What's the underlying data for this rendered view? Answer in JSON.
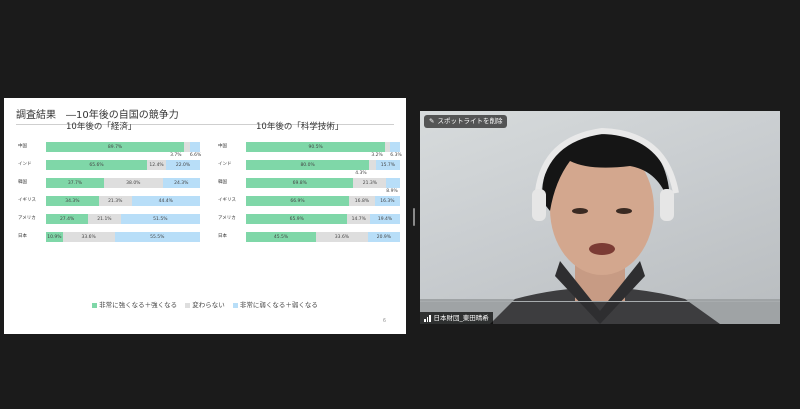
{
  "slide": {
    "title": "調査結果　―10年後の自国の競争力",
    "page_number": "6",
    "legend": [
      {
        "label": "非常に強くなる＋強くなる",
        "color": "#7fd7a8"
      },
      {
        "label": "変わらない",
        "color": "#dedede"
      },
      {
        "label": "非常に弱くなる＋弱くなる",
        "color": "#b8def8"
      }
    ]
  },
  "chart_data": [
    {
      "type": "bar",
      "title": "10年後の「経済」",
      "categories": [
        "中国",
        "インド",
        "韓国",
        "イギリス",
        "アメリカ",
        "日本"
      ],
      "series": [
        {
          "name": "非常に強くなる＋強くなる",
          "values": [
            89.7,
            65.6,
            37.7,
            34.3,
            27.4,
            10.9
          ]
        },
        {
          "name": "変わらない",
          "values": [
            3.7,
            12.4,
            38.0,
            21.3,
            21.1,
            33.6
          ]
        },
        {
          "name": "非常に弱くなる＋弱くなる",
          "values": [
            6.6,
            22.0,
            24.3,
            44.4,
            51.5,
            55.5
          ]
        }
      ],
      "labels": [
        [
          "89.7%",
          "3.7%",
          "6.6%"
        ],
        [
          "65.6%",
          "12.4%",
          "22.0%"
        ],
        [
          "37.7%",
          "38.0%",
          "24.3%"
        ],
        [
          "34.3%",
          "21.3%",
          "44.4%"
        ],
        [
          "27.4%",
          "21.1%",
          "51.5%"
        ],
        [
          "10.9%",
          "33.6%",
          "55.5%"
        ]
      ],
      "ylim": [
        0,
        100
      ]
    },
    {
      "type": "bar",
      "title": "10年後の「科学技術」",
      "categories": [
        "中国",
        "インド",
        "韓国",
        "イギリス",
        "アメリカ",
        "日本"
      ],
      "series": [
        {
          "name": "非常に強くなる＋強くなる",
          "values": [
            90.5,
            80.0,
            69.8,
            66.9,
            65.9,
            45.5
          ]
        },
        {
          "name": "変わらない",
          "values": [
            3.2,
            4.3,
            21.3,
            16.8,
            14.7,
            33.6
          ]
        },
        {
          "name": "非常に弱くなる＋弱くなる",
          "values": [
            6.3,
            15.7,
            8.9,
            16.3,
            19.4,
            20.9
          ]
        }
      ],
      "labels": [
        [
          "90.5%",
          "3.2%",
          "6.3%"
        ],
        [
          "80.0%",
          "4.3%",
          "15.7%"
        ],
        [
          "69.8%",
          "21.3%",
          "8.9%"
        ],
        [
          "66.9%",
          "16.8%",
          "16.3%"
        ],
        [
          "65.9%",
          "14.7%",
          "19.4%"
        ],
        [
          "45.5%",
          "33.6%",
          "20.9%"
        ]
      ],
      "ylim": [
        0,
        100
      ]
    }
  ],
  "video": {
    "spotlight_button": "スポットライトを削除",
    "participant_name": "日本財団_東田晴希"
  }
}
